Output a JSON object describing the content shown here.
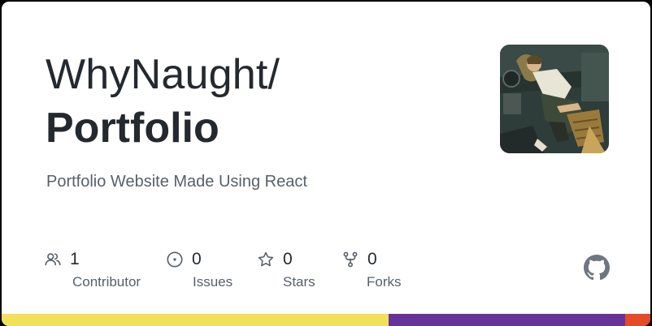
{
  "repo": {
    "owner": "WhyNaught/",
    "name": "Portfolio",
    "description": "Portfolio Website Made Using React"
  },
  "stats": [
    {
      "icon": "people-icon",
      "value": "1",
      "label": "Contributor"
    },
    {
      "icon": "issue-circle-icon",
      "value": "0",
      "label": "Issues"
    },
    {
      "icon": "star-icon",
      "value": "0",
      "label": "Stars"
    },
    {
      "icon": "fork-icon",
      "value": "0",
      "label": "Forks"
    }
  ],
  "languages": [
    {
      "color": "#f1e05a",
      "percent": 59.6
    },
    {
      "color": "#663399",
      "percent": 36.5
    },
    {
      "color": "#e34c26",
      "percent": 3.9
    }
  ],
  "colors": {
    "text_primary": "#24292f",
    "text_secondary": "#57606a",
    "icon": "#57606a"
  }
}
